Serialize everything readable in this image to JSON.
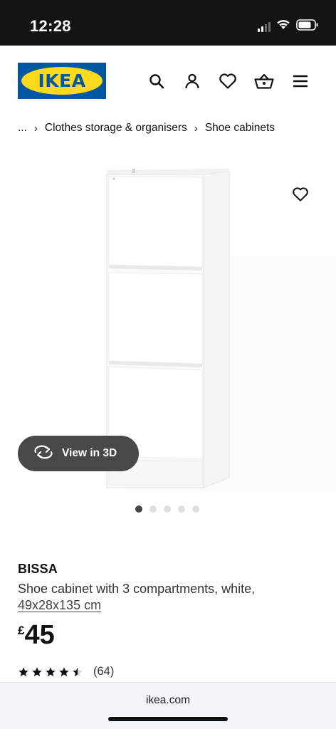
{
  "status_bar": {
    "time": "12:28",
    "icons": [
      "signal-icon",
      "wifi-icon",
      "battery-icon"
    ]
  },
  "header": {
    "logo_text": "IKEA",
    "icons": [
      "search-icon",
      "account-icon",
      "wishlist-heart-icon",
      "basket-icon",
      "menu-icon"
    ]
  },
  "breadcrumb": {
    "items": [
      "...",
      "Clothes storage & organisers",
      "Shoe cabinets"
    ],
    "separator": "›"
  },
  "gallery": {
    "view_3d_label": "View in 3D",
    "image_count": 5,
    "active_index": 0
  },
  "product": {
    "name": "BISSA",
    "description": "Shoe cabinet with 3 compartments, white,",
    "dimensions": "49x28x135 cm",
    "currency": "£",
    "price": "45",
    "rating_value": 4.5,
    "rating_max": 5,
    "review_count": "(64)"
  },
  "browser": {
    "url": "ikea.com"
  },
  "colors": {
    "ikea_blue": "#0058a3",
    "ikea_yellow": "#ffda1a",
    "status_bar": "#141414",
    "pill_bg": "#484848"
  }
}
